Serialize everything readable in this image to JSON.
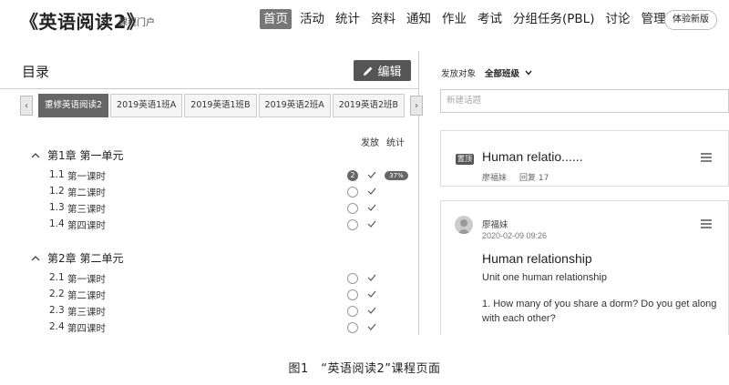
{
  "header": {
    "course_title": "《英语阅读2》",
    "portal_link": "课程门户",
    "nav": [
      "首页",
      "活动",
      "统计",
      "资料",
      "通知",
      "作业",
      "考试",
      "分组任务(PBL)",
      "讨论",
      "管理"
    ],
    "active_nav": "首页",
    "beta_button": "体验新版"
  },
  "toc": {
    "title": "目录",
    "edit_button": "编辑",
    "tab_prev": "‹",
    "tab_next": "›",
    "tabs": [
      "重修英语阅读2",
      "2019英语1班A",
      "2019英语1班B",
      "2019英语2班A",
      "2019英语2班B"
    ],
    "active_tab": "重修英语阅读2",
    "col_publish": "发放",
    "col_stats": "统计",
    "chapters": [
      {
        "title": "第1章 第一单元",
        "lessons": [
          {
            "num": "1.1",
            "name": "第一课时",
            "badge": "2",
            "pct": "37%"
          },
          {
            "num": "1.2",
            "name": "第二课时"
          },
          {
            "num": "1.3",
            "name": "第三课时"
          },
          {
            "num": "1.4",
            "name": "第四课时"
          }
        ]
      },
      {
        "title": "第2章 第二单元",
        "lessons": [
          {
            "num": "2.1",
            "name": "第一课时"
          },
          {
            "num": "2.2",
            "name": "第二课时"
          },
          {
            "num": "2.3",
            "name": "第三课时"
          },
          {
            "num": "2.4",
            "name": "第四课时"
          }
        ]
      }
    ]
  },
  "discussion": {
    "publish_label": "发放对象",
    "publish_value": "全部班级",
    "new_topic_placeholder": "新建话题",
    "posts": [
      {
        "badge": "置顶",
        "title": "Human relatio......",
        "author": "廖福妹",
        "replies": "回复 17"
      },
      {
        "author": "廖福妹",
        "date": "2020-02-09 09:26",
        "title": "Human relationship",
        "subtitle": "Unit one human relationship",
        "body": "1. How many of you share a dorm? Do you get along with each other?"
      }
    ]
  },
  "caption": "图1　“英语阅读2”课程页面"
}
